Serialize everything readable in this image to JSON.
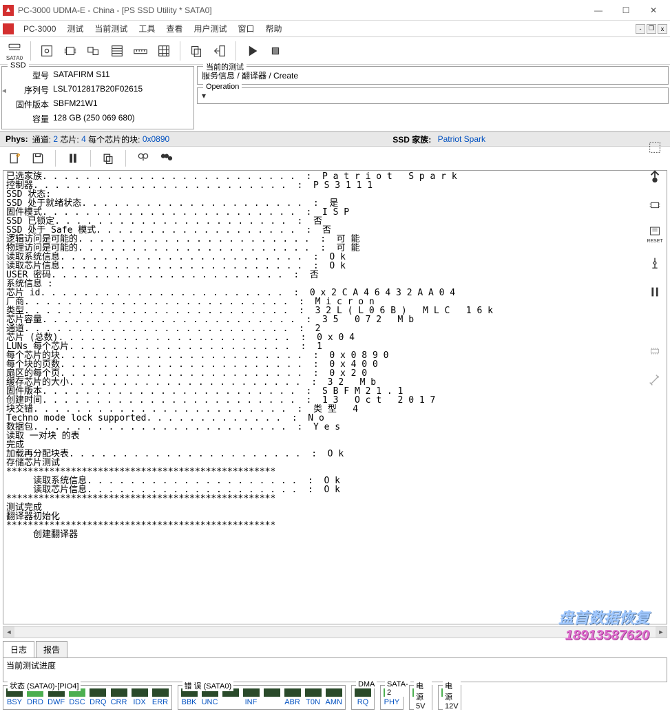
{
  "window": {
    "title": "PC-3000 UDMA-E - China - [PS SSD Utility * SATA0]"
  },
  "menubar": {
    "app_label": "PC-3000",
    "items": [
      "测试",
      "当前测试",
      "工具",
      "查看",
      "用户测试",
      "窗口",
      "帮助"
    ]
  },
  "toolbar": {
    "sata_label": "SATA0"
  },
  "ssd_panel": {
    "legend": "SSD",
    "model_label": "型号",
    "model_value": "SATAFIRM   S11",
    "serial_label": "序列号",
    "serial_value": "LSL7012817B20F02615",
    "fw_label": "固件版本",
    "fw_value": "SBFM21W1",
    "capacity_label": "容量",
    "capacity_value": "128 GB (250 069 680)"
  },
  "current_test": {
    "legend": "当前的测试",
    "path": "服务信息 / 翻译器 / Create"
  },
  "operation": {
    "legend": "Operation",
    "value": ""
  },
  "phys_bar": {
    "phys_label": "Phys:",
    "channel_label": "通道:",
    "channel_value": "2",
    "chip_label": "芯片:",
    "chip_value": "4",
    "blocks_label": "每个芯片的块:",
    "blocks_value": "0x0890",
    "ssd_family_label": "SSD 家族:",
    "ssd_family_value": "Patriot Spark"
  },
  "sidebar_reset": "RESET",
  "log_lines": [
    {
      "k": "已选家族",
      "v": "Patriot Spark"
    },
    {
      "k": "控制器",
      "v": "PS3111"
    },
    {
      "k": "",
      "v": ""
    },
    {
      "k": "SSD 状态:",
      "v": ""
    },
    {
      "k": "SSD 处于就绪状态",
      "v": "是"
    },
    {
      "k": "固件模式",
      "v": "ISP"
    },
    {
      "k": "SSD 已锁定",
      "v": "否"
    },
    {
      "k": "SSD 处于 Safe 模式",
      "v": "否"
    },
    {
      "k": "逻辑访问是可能的",
      "v": "可能"
    },
    {
      "k": "物理访问是可能的",
      "v": "可能"
    },
    {
      "k": "",
      "v": ""
    },
    {
      "k": "读取系统信息",
      "v": "Ok"
    },
    {
      "k": "读取芯片信息",
      "v": "Ok"
    },
    {
      "k": "",
      "v": ""
    },
    {
      "k": "USER 密码",
      "v": "否"
    },
    {
      "k": "",
      "v": ""
    },
    {
      "k": "系统信息 :",
      "v": ""
    },
    {
      "k": "芯片 id",
      "v": "0x2CA46432AA04"
    },
    {
      "k": "厂商",
      "v": "Micron"
    },
    {
      "k": "类型",
      "v": "32L(L06B) MLC 16k"
    },
    {
      "k": "芯片容量",
      "v": "35 072 Mb"
    },
    {
      "k": "通道",
      "v": "2"
    },
    {
      "k": "芯片 (总数)",
      "v": "0x04"
    },
    {
      "k": "LUNs 每个芯片",
      "v": "1"
    },
    {
      "k": "每个芯片的块",
      "v": "0x0890"
    },
    {
      "k": "每个块的页数",
      "v": "0x400"
    },
    {
      "k": "扇区的每个页",
      "v": "0x20"
    },
    {
      "k": "缓存芯片的大小",
      "v": "32 Mb"
    },
    {
      "k": "固件版本",
      "v": "SBFM21.1"
    },
    {
      "k": "创建时间",
      "v": "13 Oct 2017"
    },
    {
      "k": "块交错",
      "v": "类型 4"
    },
    {
      "k": "Techno mode lock supported",
      "v": "No"
    },
    {
      "k": "数据包",
      "v": "Yes"
    },
    {
      "k": "",
      "v": ""
    },
    {
      "k": "读取 一对块 的表",
      "v": ""
    },
    {
      "k": "完成",
      "v": ""
    },
    {
      "k": "",
      "v": ""
    },
    {
      "k": "加载再分配块表",
      "v": "Ok"
    },
    {
      "k": "",
      "v": ""
    },
    {
      "k": "存储芯片测试",
      "v": ""
    },
    {
      "k": "**************************************************",
      "v": ""
    },
    {
      "k": "     读取系统信息",
      "v": "Ok",
      "indent": true
    },
    {
      "k": "     读取芯片信息",
      "v": "Ok",
      "indent": true
    },
    {
      "k": "**************************************************",
      "v": ""
    },
    {
      "k": "测试完成",
      "v": ""
    },
    {
      "k": "",
      "v": ""
    },
    {
      "k": "翻译器初始化",
      "v": ""
    },
    {
      "k": "**************************************************",
      "v": ""
    },
    {
      "k": "     创建翻译器",
      "v": ""
    }
  ],
  "tabs": {
    "active": "日志",
    "other": "报告"
  },
  "progress": {
    "label": "当前测试进度"
  },
  "status": {
    "group1_legend": "状态 (SATA0)-[PIO4]",
    "group1_leds": [
      {
        "label": "BSY",
        "on": false,
        "color": "blue"
      },
      {
        "label": "DRD",
        "on": true,
        "color": "blue"
      },
      {
        "label": "DWF",
        "on": false,
        "color": "blue"
      },
      {
        "label": "DSC",
        "on": true,
        "color": "blue"
      },
      {
        "label": "DRQ",
        "on": false,
        "color": "blue"
      },
      {
        "label": "CRR",
        "on": false,
        "color": "blue"
      },
      {
        "label": "IDX",
        "on": false,
        "color": "blue"
      },
      {
        "label": "ERR",
        "on": false,
        "color": "blue"
      }
    ],
    "group2_legend": "错 误 (SATA0)",
    "group2_leds": [
      {
        "label": "BBK",
        "on": false,
        "color": "blue"
      },
      {
        "label": "UNC",
        "on": false,
        "color": "blue"
      },
      {
        "label": "",
        "on": false,
        "color": "blue"
      },
      {
        "label": "INF",
        "on": false,
        "color": "blue"
      },
      {
        "label": "",
        "on": false,
        "color": "blue"
      },
      {
        "label": "ABR",
        "on": false,
        "color": "blue"
      },
      {
        "label": "T0N",
        "on": false,
        "color": "blue"
      },
      {
        "label": "AMN",
        "on": false,
        "color": "blue"
      }
    ],
    "group3_legend": "DMA",
    "group3_leds": [
      {
        "label": "RQ",
        "on": false,
        "color": "blue"
      }
    ],
    "group4_legend": "SATA-2",
    "group4_leds": [
      {
        "label": "PHY",
        "on": true,
        "color": "blue"
      }
    ],
    "group5_legend": "电源 5V",
    "group5_leds": [
      {
        "label": "5V",
        "on": true,
        "color": "blue"
      }
    ],
    "group6_legend": "电源 12V",
    "group6_leds": [
      {
        "label": "12V",
        "on": true,
        "color": "red"
      }
    ]
  },
  "watermark": {
    "line1": "盘首数据恢复",
    "line2": "18913587620"
  }
}
